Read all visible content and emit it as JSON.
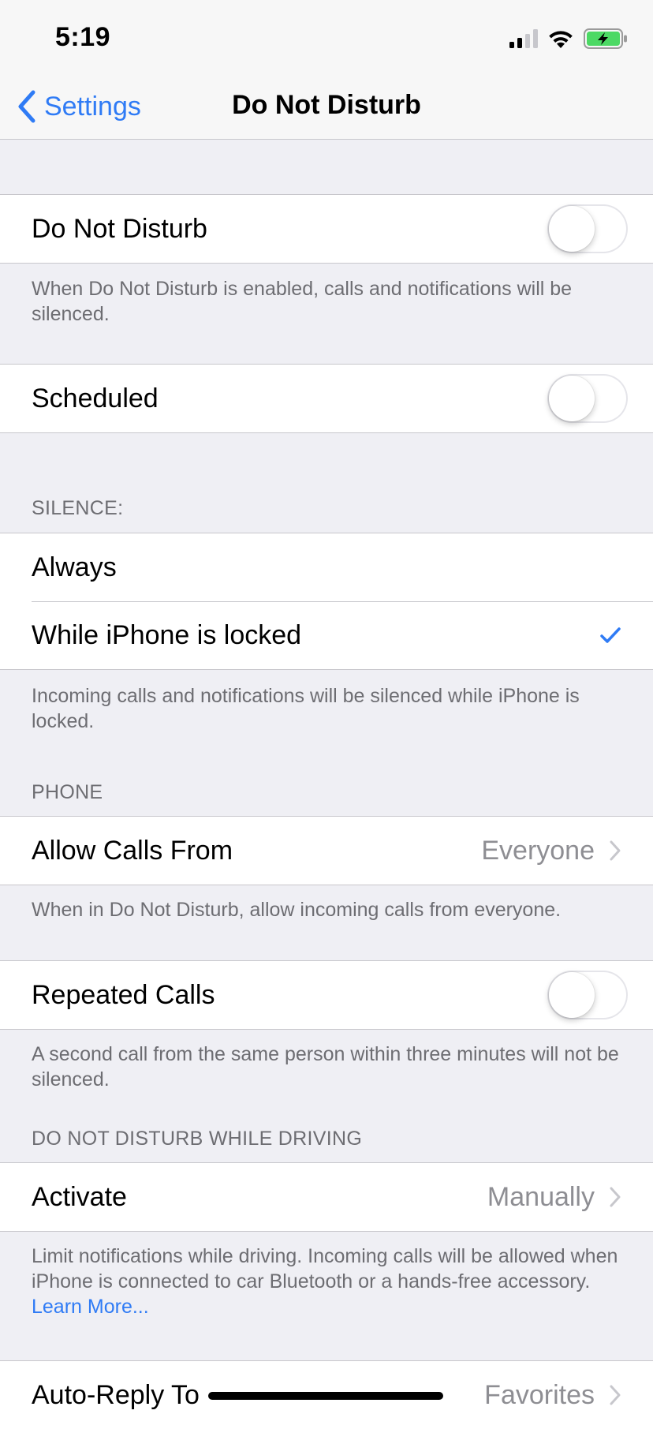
{
  "status_bar": {
    "time": "5:19",
    "icons": [
      "cellular-signal-icon",
      "wifi-icon",
      "battery-charging-icon"
    ],
    "battery_color": "#4cd964"
  },
  "nav": {
    "back_label": "Settings",
    "title": "Do Not Disturb",
    "accent_color": "#2f7bf5"
  },
  "dnd": {
    "label": "Do Not Disturb",
    "enabled": false,
    "footer": "When Do Not Disturb is enabled, calls and notifications will be silenced."
  },
  "scheduled": {
    "label": "Scheduled",
    "enabled": false
  },
  "silence": {
    "header": "SILENCE:",
    "options": [
      {
        "label": "Always",
        "selected": false
      },
      {
        "label": "While iPhone is locked",
        "selected": true
      }
    ],
    "footer": "Incoming calls and notifications will be silenced while iPhone is locked."
  },
  "phone": {
    "header": "PHONE",
    "allow_calls": {
      "label": "Allow Calls From",
      "value": "Everyone"
    },
    "footer": "When in Do Not Disturb, allow incoming calls from everyone.",
    "repeated_calls": {
      "label": "Repeated Calls",
      "enabled": false
    },
    "repeated_footer": "A second call from the same person within three minutes will not be silenced."
  },
  "driving": {
    "header": "DO NOT DISTURB WHILE DRIVING",
    "activate": {
      "label": "Activate",
      "value": "Manually"
    },
    "footer_text": "Limit notifications while driving. Incoming calls will be allowed when iPhone is connected to car Bluetooth or a hands-free accessory.",
    "footer_link": "Learn More...",
    "auto_reply": {
      "label": "Auto-Reply To",
      "value": "Favorites"
    }
  }
}
